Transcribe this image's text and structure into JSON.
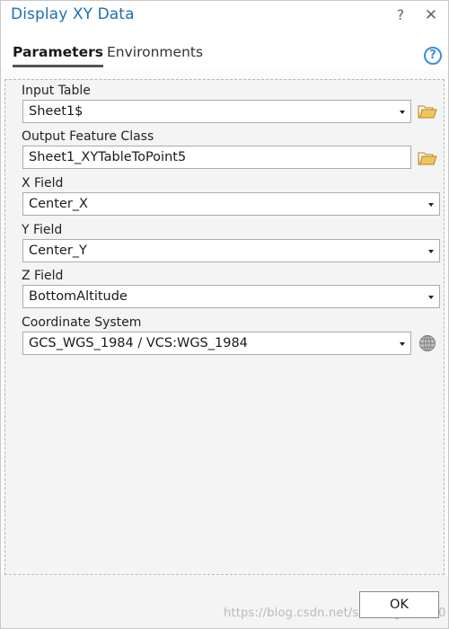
{
  "window": {
    "title": "Display XY Data",
    "help_glyph": "?",
    "close_glyph": "✕"
  },
  "tabs": {
    "parameters": "Parameters",
    "environments": "Environments",
    "help_glyph": "?"
  },
  "params": {
    "input_table": {
      "label": "Input Table",
      "value": "Sheet1$"
    },
    "output_feature_class": {
      "label": "Output Feature Class",
      "value": "Sheet1_XYTableToPoint5"
    },
    "x_field": {
      "label": "X Field",
      "value": "Center_X"
    },
    "y_field": {
      "label": "Y Field",
      "value": "Center_Y"
    },
    "z_field": {
      "label": "Z Field",
      "value": "BottomAltitude"
    },
    "coordinate_system": {
      "label": "Coordinate System",
      "value": "GCS_WGS_1984 / VCS:WGS_1984"
    }
  },
  "icons": {
    "browse": "folder-icon",
    "spatial_reference": "globe-icon",
    "help": "help-icon",
    "close": "close-icon",
    "dropdown": "chevron-down-icon"
  },
  "colors": {
    "title": "#1e6fb0",
    "help_accent": "#3c8fd6",
    "folder": "#e8b03a"
  },
  "footer": {
    "ok_label": "OK",
    "watermark": "https://blog.csdn.net/suntongxue100"
  }
}
